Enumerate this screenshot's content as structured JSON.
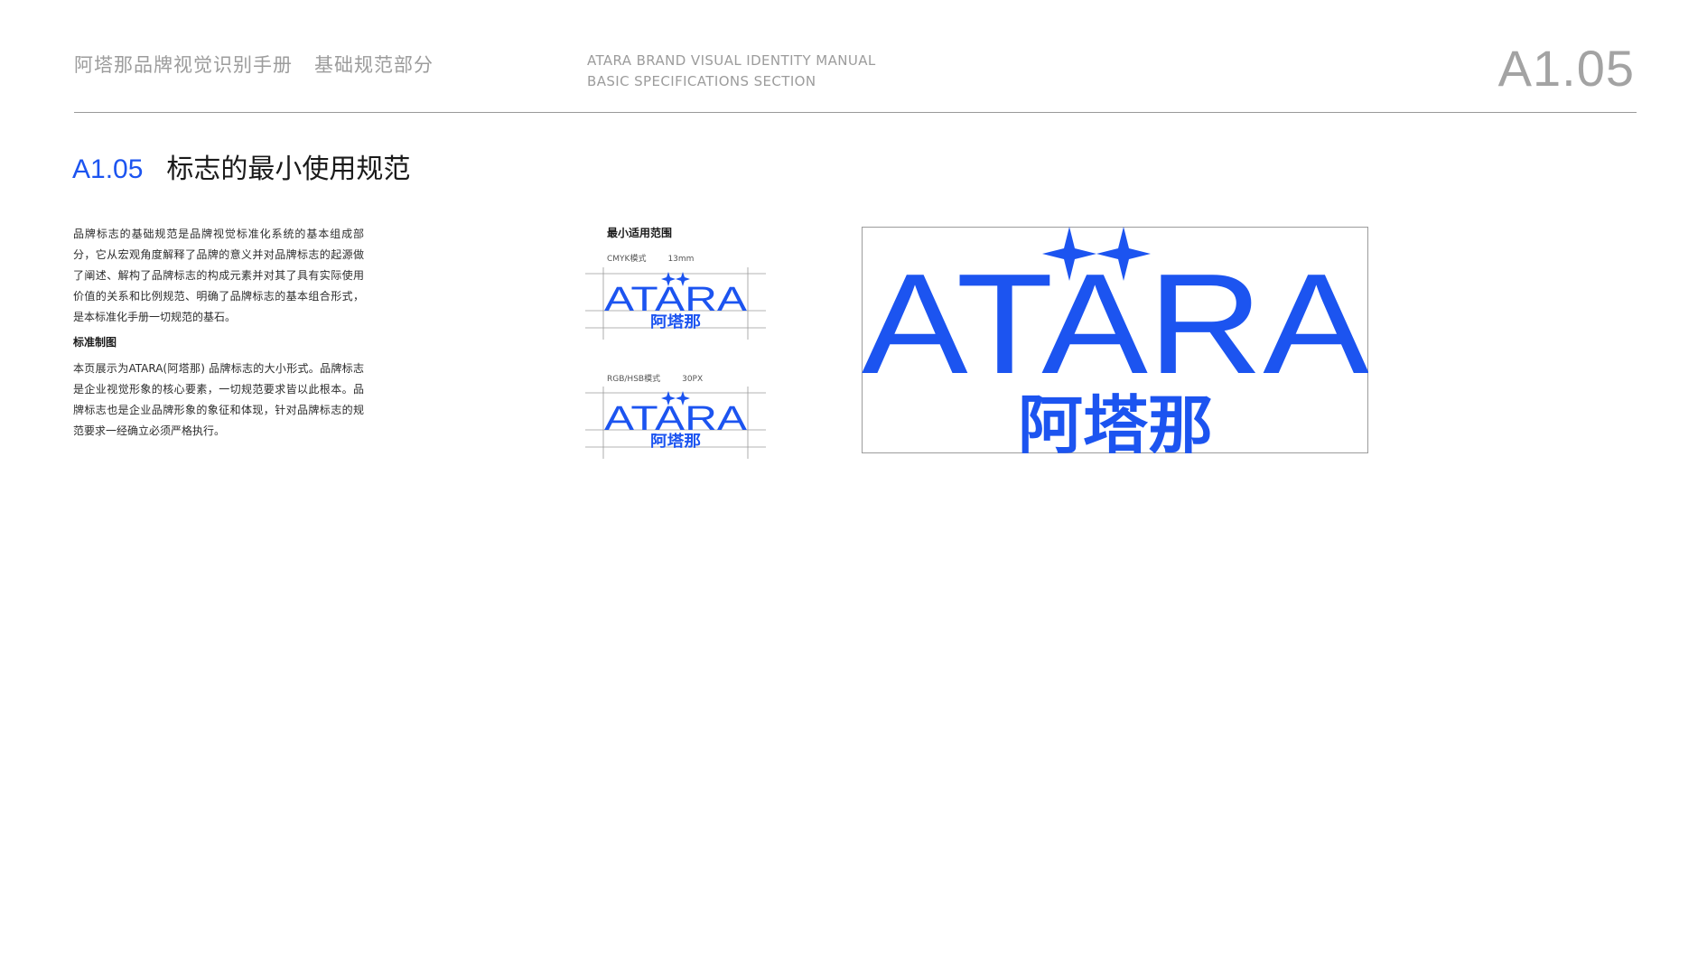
{
  "header": {
    "title_cn": "阿塔那品牌视觉识别手册",
    "section_cn": "基础规范部分",
    "title_en": "ATARA BRAND VISUAL IDENTITY MANUAL",
    "section_en": "BASIC SPECIFICATIONS SECTION",
    "page_number": "A1.05"
  },
  "section": {
    "number": "A1.05",
    "title": "标志的最小使用规范"
  },
  "body": {
    "paragraph_1": "品牌标志的基础规范是品牌视觉标准化系统的基本组成部分，它从宏观角度解释了品牌的意义并对品牌标志的起源做了阐述、解构了品牌标志的构成元素并对其了具有实际使用价值的关系和比例规范、明确了品牌标志的基本组合形式，是本标准化手册一切规范的基石。",
    "heading": "标准制图",
    "paragraph_2": "本页展示为ATARA(阿塔那) 品牌标志的大小形式。品牌标志是企业视觉形象的核心要素，一切规范要求皆以此根本。品牌标志也是企业品牌形象的象征和体现，针对品牌标志的规范要求一经确立必须严格执行。"
  },
  "minimum_usage": {
    "title": "最小适用范围",
    "cmyk_mode": "CMYK模式",
    "cmyk_size": "13mm",
    "rgb_mode": "RGB/HSB模式",
    "rgb_size": "30PX"
  },
  "logo": {
    "wordmark": "ATARA",
    "chinese": "阿塔那",
    "color": "#1c54f0"
  },
  "colors": {
    "accent": "#1c54f0",
    "header_gray": "#9c9c9c",
    "text": "#2c2c2c"
  }
}
